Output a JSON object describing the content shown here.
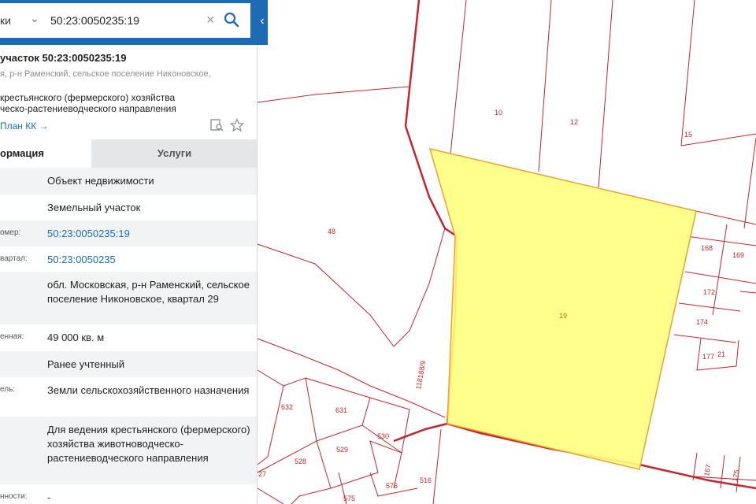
{
  "search": {
    "type_label": "ки",
    "value": "50:23:0050235:19",
    "clear_icon": "close-icon",
    "search_icon": "search-icon"
  },
  "object": {
    "title": "участок 50:23:0050235:19",
    "address_line": "я, р-н Раменский, сельское поселение Никоновское,",
    "purpose_line1": "крестьянского (фермерского) хозяйства",
    "purpose_line2": "ческо-растениеводческого направления",
    "plan_link": "План КК →"
  },
  "tabs": [
    {
      "label": "ормация"
    },
    {
      "label": "Услуги"
    }
  ],
  "rows": [
    {
      "label": "",
      "value": "Объект недвижимости"
    },
    {
      "label": "",
      "value": "Земельный участок"
    },
    {
      "label": "омер:",
      "value": "50:23:0050235:19"
    },
    {
      "label": "вартал:",
      "value": "50:23:0050235"
    },
    {
      "label": "",
      "value": "обл. Московская, р-н Раменский, сельское поселение Никоновское, квартал 29"
    },
    {
      "label": "енная:",
      "value": "49 000 кв. м"
    },
    {
      "label": "",
      "value": "Ранее учтенный"
    },
    {
      "label": "ель:",
      "value": "Земли сельскохозяйственного назначения"
    },
    {
      "label": "",
      "value": "Для ведения крестьянского (фермерского) хозяйства животноводческо-растениеводческого направления"
    },
    {
      "label": "нности:",
      "value": "-"
    }
  ],
  "map": {
    "colors": {
      "boundary": "#c1272d",
      "selected_fill": "#ffff80",
      "selected_stroke": "#f0a030"
    },
    "labels": [
      "10",
      "12",
      "15",
      "48",
      "19",
      "168",
      "169",
      "172",
      "174",
      "177",
      "21",
      "118188/9",
      "632",
      "631",
      "530",
      "529",
      "528",
      "27",
      "576",
      "575",
      "516",
      "167",
      "175"
    ]
  }
}
